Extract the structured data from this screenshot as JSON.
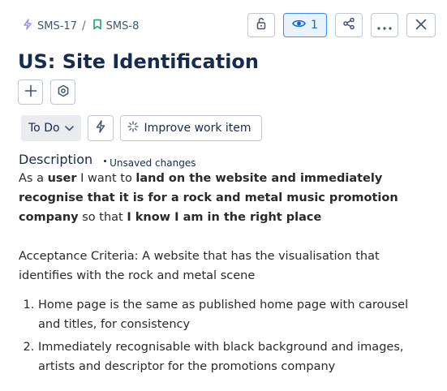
{
  "breadcrumb": {
    "items": [
      {
        "label": "SMS-17",
        "icon": "epic-bolt-icon",
        "color": "#9f8fef"
      },
      {
        "label": "SMS-8",
        "icon": "story-bookmark-icon",
        "color": "#22a06b"
      }
    ],
    "separator": "/"
  },
  "toolbar": {
    "watch_count": "1",
    "icons": [
      "unlock-icon",
      "eye-icon",
      "share-icon",
      "more-icon",
      "close-icon"
    ]
  },
  "title": "US: Site Identification",
  "status": {
    "label": "To Do"
  },
  "improve_label": "Improve work item",
  "description": {
    "heading": "Description",
    "unsaved": "Unsaved changes",
    "story": [
      {
        "text": "As a ",
        "bold": false
      },
      {
        "text": "user",
        "bold": true
      },
      {
        "text": " I want to ",
        "bold": false
      },
      {
        "text": "land on the website and immediately recognise that it is for a rock and metal music promotion company",
        "bold": true
      },
      {
        "text": " so that ",
        "bold": false
      },
      {
        "text": "I know I am in the right place",
        "bold": true
      }
    ],
    "acceptance": "Acceptance Criteria: A website that has the visualisation that identifies with the rock and metal scene",
    "criteria": [
      "Home page is the same as published home page with carousel and titles, for consistency",
      "Immediately recognisable with black background and images, artists and descriptor for the promotions company"
    ]
  },
  "colors": {
    "accent": "#0c66e4",
    "text": "#172b4d",
    "watch_bg": "#e9f2ff"
  }
}
